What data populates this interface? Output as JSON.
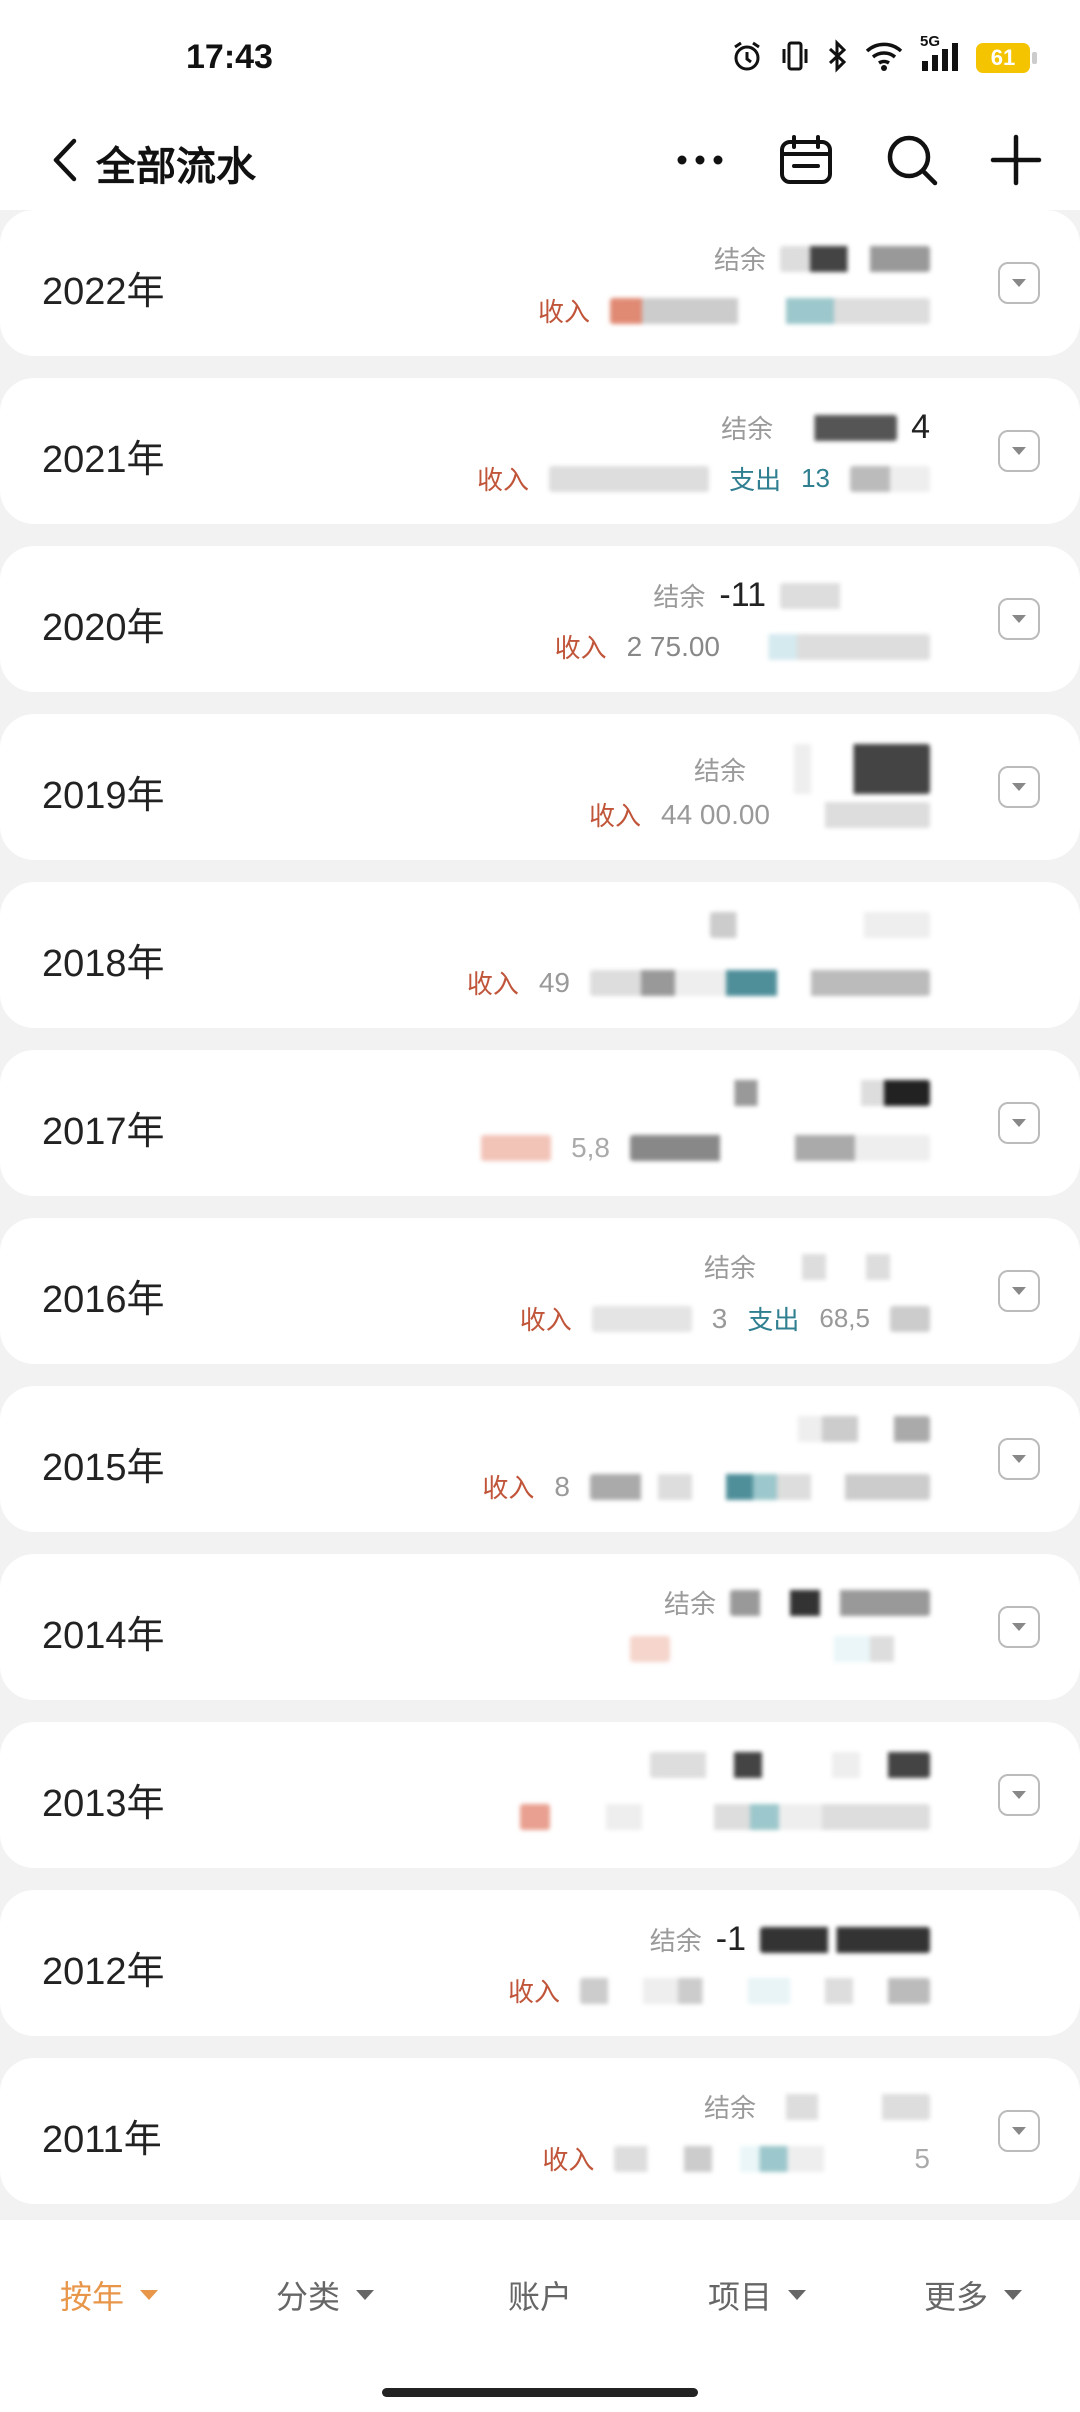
{
  "status_bar": {
    "time": "17:43",
    "network": "5G",
    "battery": "61",
    "icons": [
      "alarm-icon",
      "vibrate-icon",
      "bluetooth-icon",
      "wifi-icon",
      "signal-icon",
      "battery-icon"
    ]
  },
  "header": {
    "title": "全部流水",
    "icons": [
      "back-icon",
      "more-icon",
      "calendar-icon",
      "search-icon",
      "add-icon"
    ]
  },
  "labels": {
    "balance": "结余",
    "income": "收入",
    "expense": "支出"
  },
  "years": [
    {
      "year": "2022年",
      "balance": "",
      "income": "",
      "expense": ""
    },
    {
      "year": "2021年",
      "balance": "4",
      "income": "",
      "expense": "13"
    },
    {
      "year": "2020年",
      "balance": "-11",
      "income": "2 75.00",
      "expense": ""
    },
    {
      "year": "2019年",
      "balance": "",
      "income": "44 00.00",
      "expense": ""
    },
    {
      "year": "2018年",
      "balance": "",
      "income": "49",
      "expense": ""
    },
    {
      "year": "2017年",
      "balance": "",
      "income": "5,8",
      "expense": ""
    },
    {
      "year": "2016年",
      "balance": "",
      "income": "3",
      "expense": "68,5"
    },
    {
      "year": "2015年",
      "balance": "",
      "income": "8",
      "expense": ""
    },
    {
      "year": "2014年",
      "balance": "",
      "income": "",
      "expense": ""
    },
    {
      "year": "2013年",
      "balance": "",
      "income": "",
      "expense": ""
    },
    {
      "year": "2012年",
      "balance": "-1",
      "income": "",
      "expense": ""
    },
    {
      "year": "2011年",
      "balance": "",
      "income": "",
      "expense": "5"
    }
  ],
  "bottom_nav": [
    {
      "label": "按年",
      "caret": true,
      "active": true
    },
    {
      "label": "分类",
      "caret": true,
      "active": false
    },
    {
      "label": "账户",
      "caret": false,
      "active": false
    },
    {
      "label": "项目",
      "caret": true,
      "active": false
    },
    {
      "label": "更多",
      "caret": true,
      "active": false
    }
  ],
  "colors": {
    "accent": "#e8964a",
    "income": "#c0553a",
    "expense": "#2f7f90",
    "background": "#f2f2f2"
  }
}
